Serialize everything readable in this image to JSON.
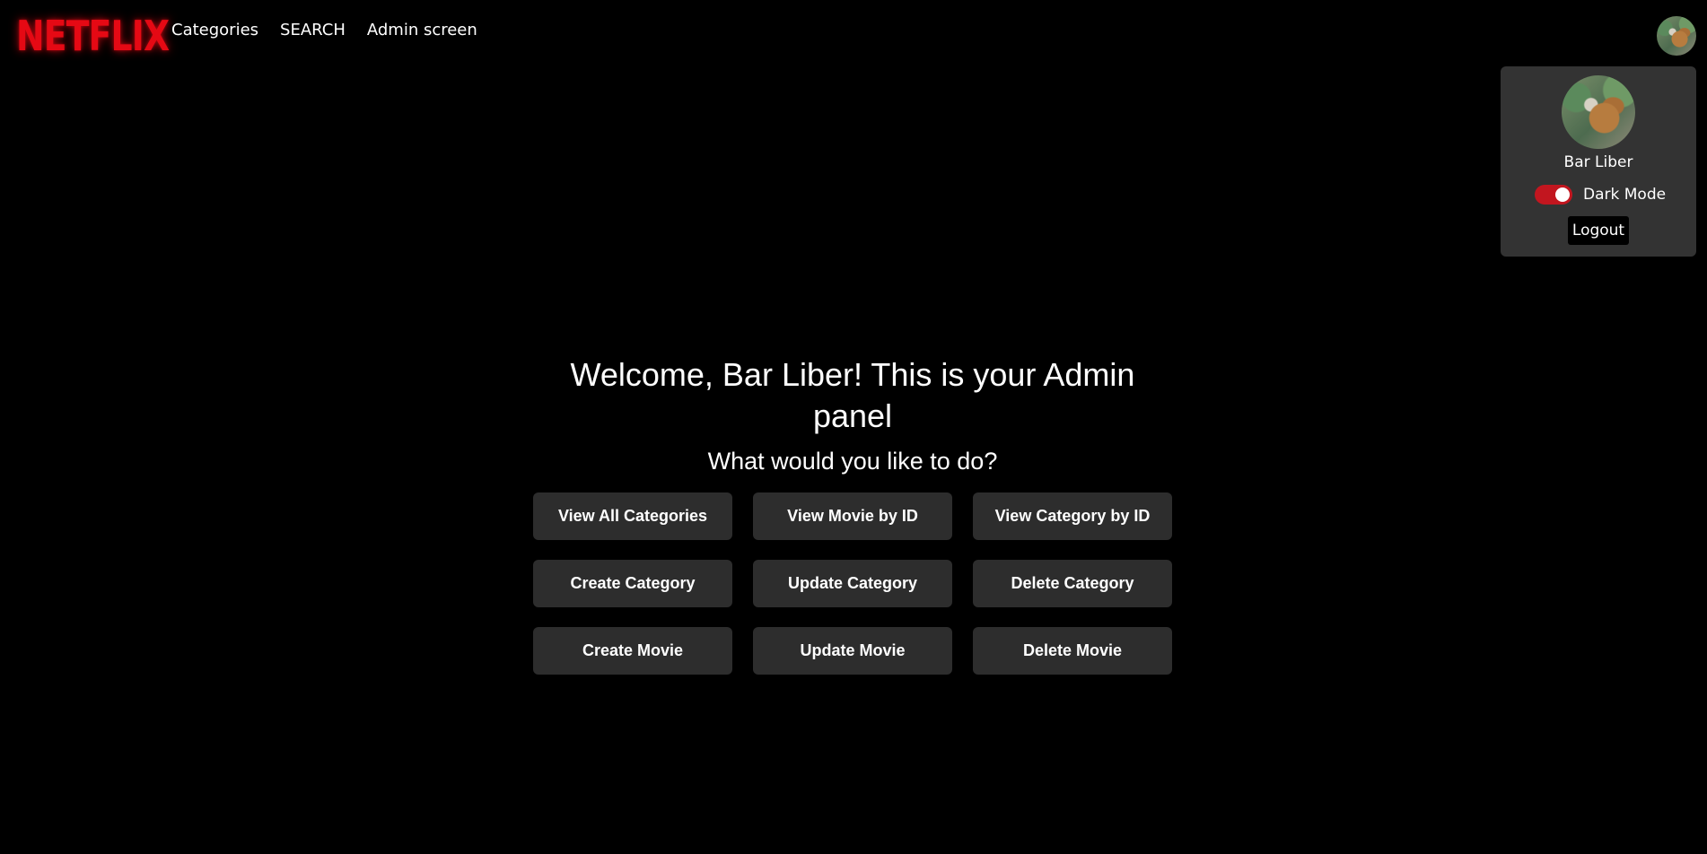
{
  "brand": {
    "logo_text": "NETFLIX",
    "accent_color": "#e50914"
  },
  "nav": {
    "links": [
      {
        "label": "Categories"
      },
      {
        "label": "SEARCH"
      },
      {
        "label": "Admin screen"
      }
    ]
  },
  "profile": {
    "avatar_icon": "user-avatar-dog-photo",
    "name": "Bar Liber",
    "dark_mode_label": "Dark Mode",
    "dark_mode_on": true,
    "logout_label": "Logout"
  },
  "panel": {
    "title": "Welcome, Bar Liber! This is your Admin panel",
    "subtitle": "What would you like to do?",
    "buttons": [
      {
        "label": "View All Categories"
      },
      {
        "label": "View Movie by ID"
      },
      {
        "label": "View Category by ID"
      },
      {
        "label": "Create Category"
      },
      {
        "label": "Update Category"
      },
      {
        "label": "Delete Category"
      },
      {
        "label": "Create Movie"
      },
      {
        "label": "Update Movie"
      },
      {
        "label": "Delete Movie"
      }
    ]
  },
  "colors": {
    "background": "#000000",
    "menu_background": "#333333",
    "button_background": "#2d2d2d",
    "toggle_on": "#c2161f"
  }
}
